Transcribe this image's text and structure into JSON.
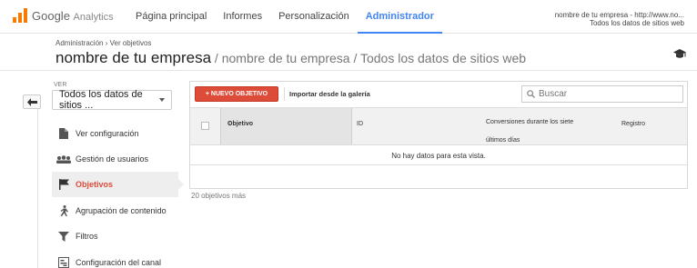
{
  "app": {
    "logo_google": "Google",
    "logo_analytics": "Analytics",
    "accent_color": "#4285f4",
    "brand_color": "#f57c00",
    "danger_color": "#dd4b39"
  },
  "nav": {
    "items": [
      "Página principal",
      "Informes",
      "Personalización",
      "Administrador"
    ],
    "active_index": 3
  },
  "account": {
    "line1": "nombre de tu empresa - http://www.no...",
    "line2": "Todos los datos de sitios web"
  },
  "header": {
    "breadcrumb_1": "Administración",
    "breadcrumb_sep": "›",
    "breadcrumb_2": "Ver objetivos",
    "title": "nombre de tu empresa",
    "subtitle": " / nombre de tu empresa / Todos los datos de sitios web"
  },
  "sidebar": {
    "view_label": "VER",
    "view_value": "Todos los datos de sitios ...",
    "items": [
      {
        "label": "Ver configuración",
        "icon": "document-icon"
      },
      {
        "label": "Gestión de usuarios",
        "icon": "users-icon"
      },
      {
        "label": "Objetivos",
        "icon": "flag-icon"
      },
      {
        "label": "Agrupación de contenido",
        "icon": "person-walk-icon"
      },
      {
        "label": "Filtros",
        "icon": "filter-icon"
      },
      {
        "label": "Configuración del canal",
        "icon": "channel-icon"
      }
    ],
    "active_index": 2
  },
  "toolbar": {
    "new_goal": "+ NUEVO OBJETIVO",
    "import": "Importar desde la galería",
    "search_placeholder": "Buscar"
  },
  "table": {
    "columns": [
      "Objetivo",
      "ID",
      "Conversiones durante los siete últimos días",
      "Registro"
    ],
    "sort_indicator": "↓",
    "empty_message": "No hay datos para esta vista."
  },
  "footer": {
    "more": "20 objetivos más"
  }
}
